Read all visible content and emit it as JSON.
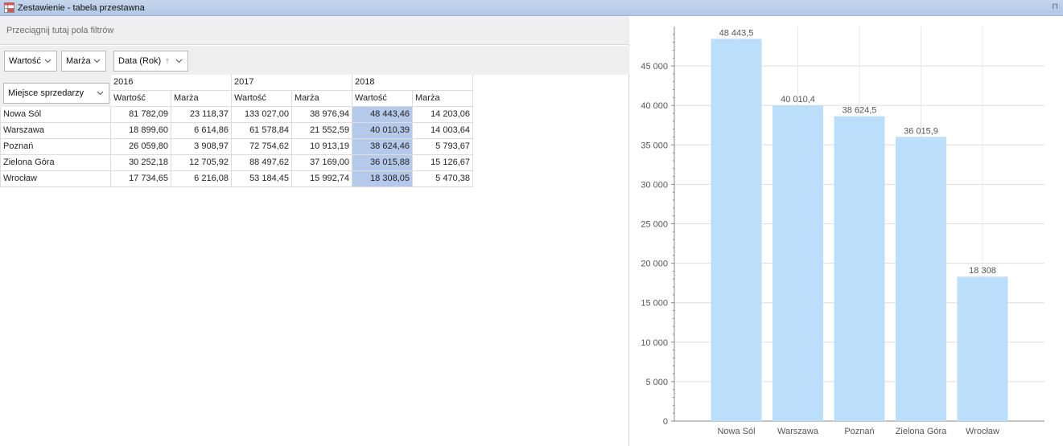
{
  "window": {
    "title": "Zestawienie - tabela przestawna",
    "pin_glyph": "⊓"
  },
  "filter_area": {
    "placeholder": "Przeciągnij tutaj pola filtrów"
  },
  "data_fields": [
    {
      "label": "Wartość"
    },
    {
      "label": "Marża"
    }
  ],
  "column_field": {
    "label": "Data (Rok)",
    "sort_glyph": "↑"
  },
  "row_field": {
    "label": "Miejsce sprzedarzy"
  },
  "table": {
    "years": [
      "2016",
      "2017",
      "2018"
    ],
    "measures": [
      "Wartość",
      "Marża"
    ],
    "rows": [
      {
        "label": "Nowa Sól",
        "values": [
          "81 782,09",
          "23 118,37",
          "133 027,00",
          "38 976,94",
          "48 443,46",
          "14 203,06"
        ]
      },
      {
        "label": "Warszawa",
        "values": [
          "18 899,60",
          "6 614,86",
          "61 578,84",
          "21 552,59",
          "40 010,39",
          "14 003,64"
        ]
      },
      {
        "label": "Poznań",
        "values": [
          "26 059,80",
          "3 908,97",
          "72 754,62",
          "10 913,19",
          "38 624,46",
          "5 793,67"
        ]
      },
      {
        "label": "Zielona Góra",
        "values": [
          "30 252,18",
          "12 705,92",
          "88 497,62",
          "37 169,00",
          "36 015,88",
          "15 126,67"
        ]
      },
      {
        "label": "Wrocław",
        "values": [
          "17 734,65",
          "6 216,08",
          "53 184,45",
          "15 992,74",
          "18 308,05",
          "5 470,38"
        ]
      }
    ],
    "selected_column_index": 4,
    "selection_color": "#b5c9ea"
  },
  "chart_data": {
    "type": "bar",
    "categories": [
      "Nowa Sól",
      "Warszawa",
      "Poznań",
      "Zielona Góra",
      "Wrocław"
    ],
    "values": [
      48443.5,
      40010.4,
      38624.5,
      36015.9,
      18308
    ],
    "data_labels": [
      "48 443,5",
      "40 010,4",
      "38 624,5",
      "36 015,9",
      "18 308"
    ],
    "y_ticks": [
      0,
      5000,
      10000,
      15000,
      20000,
      25000,
      30000,
      35000,
      40000,
      45000
    ],
    "y_tick_labels": [
      "0",
      "5 000",
      "10 000",
      "15 000",
      "20 000",
      "25 000",
      "30 000",
      "35 000",
      "40 000",
      "45 000"
    ],
    "ylim": [
      0,
      50000
    ],
    "grid": true,
    "bar_color": "#bbdefb",
    "title": "",
    "xlabel": "",
    "ylabel": ""
  }
}
